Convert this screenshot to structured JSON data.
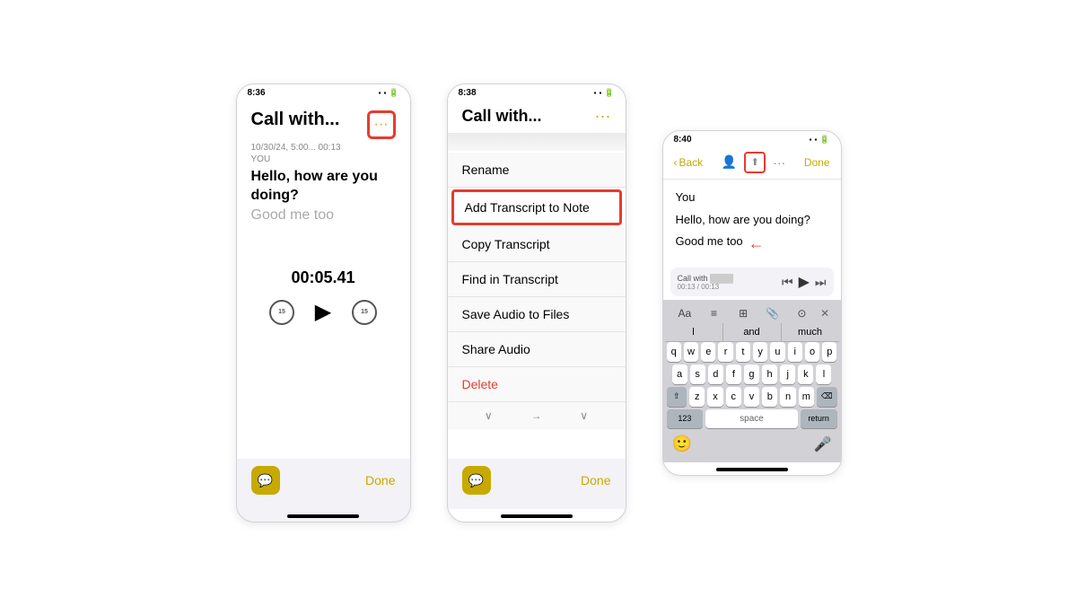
{
  "page": {
    "background": "#ffffff"
  },
  "phone1": {
    "status_time": "8:36",
    "status_icons": "▪ ▪ 🔋",
    "title": "Call with...",
    "date": "10/30/24, 5:00... 00:13",
    "you_label": "YOU",
    "transcript_line1": "Hello, how are you doing?",
    "transcript_line2": "Good me too",
    "audio_time": "00:05.41",
    "skip_back": "15",
    "skip_fwd": "15",
    "done_label": "Done"
  },
  "phone2": {
    "status_time": "8:38",
    "title": "Call with...",
    "menu_items": [
      {
        "label": "Rename",
        "highlighted": false,
        "red": false
      },
      {
        "label": "Add Transcript to Note",
        "highlighted": true,
        "red": false
      },
      {
        "label": "Copy Transcript",
        "highlighted": false,
        "red": false
      },
      {
        "label": "Find in Transcript",
        "highlighted": false,
        "red": false
      },
      {
        "label": "Save Audio to Files",
        "highlighted": false,
        "red": false
      },
      {
        "label": "Share Audio",
        "highlighted": false,
        "red": false
      },
      {
        "label": "Delete",
        "highlighted": false,
        "red": true
      }
    ],
    "done_label": "Done"
  },
  "phone3": {
    "status_time": "8:40",
    "back_label": "Back",
    "done_label": "Done",
    "note_line1": "You",
    "note_line2": "Hello, how are you doing?",
    "note_line3": "Good me too",
    "audio_label": "Call with",
    "audio_time": "00:13 / 00:13",
    "words": [
      "l",
      "and",
      "much"
    ],
    "keyboard_rows": [
      [
        "q",
        "w",
        "e",
        "r",
        "t",
        "y",
        "u",
        "i",
        "o",
        "p"
      ],
      [
        "a",
        "s",
        "d",
        "f",
        "g",
        "h",
        "j",
        "k",
        "l"
      ],
      [
        "z",
        "x",
        "c",
        "v",
        "b",
        "n",
        "m"
      ],
      [
        "123",
        "space",
        "return"
      ]
    ]
  }
}
